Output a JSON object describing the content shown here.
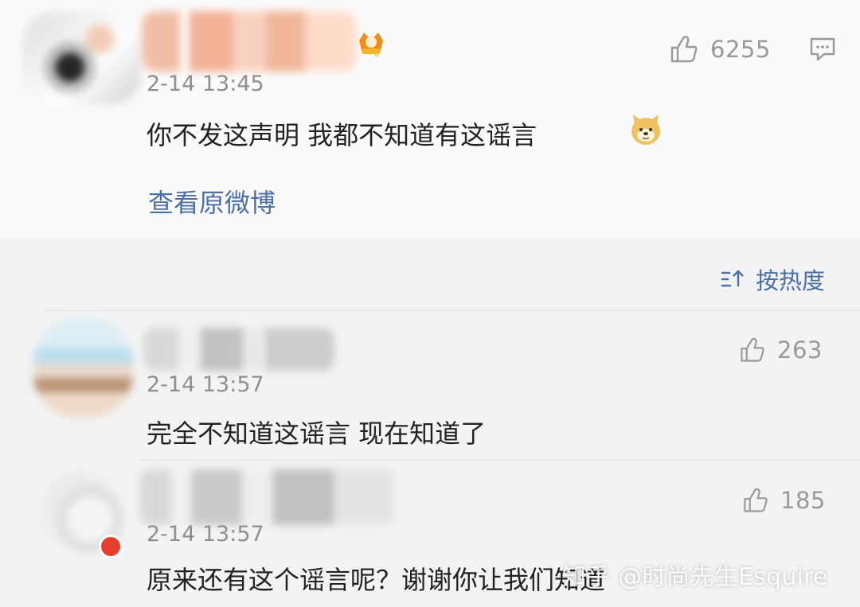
{
  "main_comment": {
    "time": "2-14 13:45",
    "text": "你不发这声明 我都不知道有这谣言",
    "likes": "6255",
    "view_link": "查看原微博"
  },
  "sort": {
    "label": "按热度"
  },
  "comments": [
    {
      "time": "2-14 13:57",
      "text": "完全不知道这谣言 现在知道了",
      "likes": "263"
    },
    {
      "time": "2-14 13:57",
      "text": "原来还有这个谣言呢？谢谢你让我们知道",
      "likes": "185"
    }
  ],
  "watermark": "知乎 @时尚先生Esquire",
  "icons": {
    "like": "thumb-up-icon",
    "comment": "comment-icon",
    "sort": "sort-icon",
    "badge": "vip-badge-icon",
    "emoji": "doge-emoji-icon"
  },
  "colors": {
    "link": "#4b6fa6",
    "meta": "#8f8f8f",
    "text": "#222222",
    "background": "#f3f3f3"
  }
}
